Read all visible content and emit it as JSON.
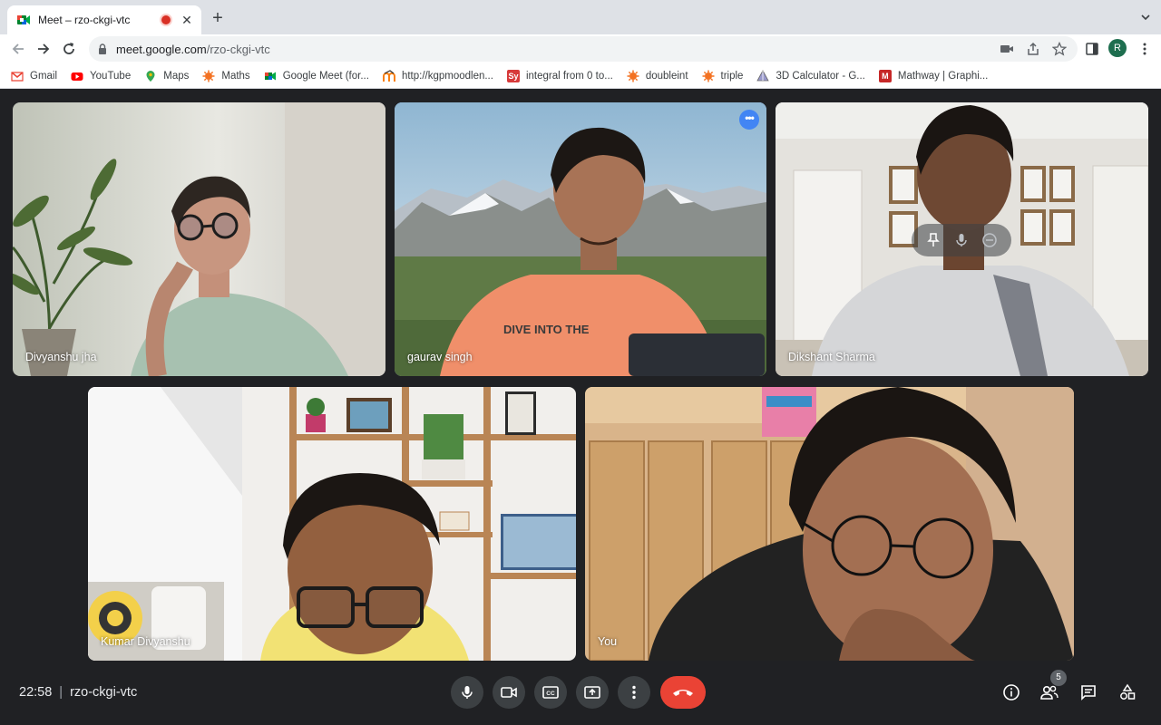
{
  "browser": {
    "tab_title": "Meet – rzo-ckgi-vtc",
    "url_host": "meet.google.com",
    "url_path": "/rzo-ckgi-vtc",
    "profile_initial": "R",
    "bookmarks": [
      {
        "label": "Gmail",
        "icon": "gmail-icon"
      },
      {
        "label": "YouTube",
        "icon": "youtube-icon"
      },
      {
        "label": "Maps",
        "icon": "maps-icon"
      },
      {
        "label": "Maths",
        "icon": "wolfram-icon"
      },
      {
        "label": "Google Meet (for...",
        "icon": "meet-icon"
      },
      {
        "label": "http://kgpmoodlen...",
        "icon": "moodle-icon"
      },
      {
        "label": "integral from 0 to...",
        "icon": "symbolab-icon"
      },
      {
        "label": "doubleint",
        "icon": "wolfram-icon"
      },
      {
        "label": "triple",
        "icon": "wolfram-icon"
      },
      {
        "label": "3D Calculator - G...",
        "icon": "geogebra-icon"
      },
      {
        "label": "Mathway | Graphi...",
        "icon": "mathway-icon"
      }
    ]
  },
  "meet": {
    "participants": [
      {
        "name": "Divyanshu jha"
      },
      {
        "name": "gaurav singh"
      },
      {
        "name": "Dikshant Sharma"
      },
      {
        "name": "Kumar Divyanshu"
      },
      {
        "name": "You"
      }
    ],
    "time": "22:58",
    "meeting_code": "rzo-ckgi-vtc",
    "participant_count": "5"
  },
  "colors": {
    "meet_bg": "#202124",
    "end_call": "#ea4335",
    "active_speaker_outline": "#8ab4f8",
    "control_bg": "#3c4043"
  }
}
